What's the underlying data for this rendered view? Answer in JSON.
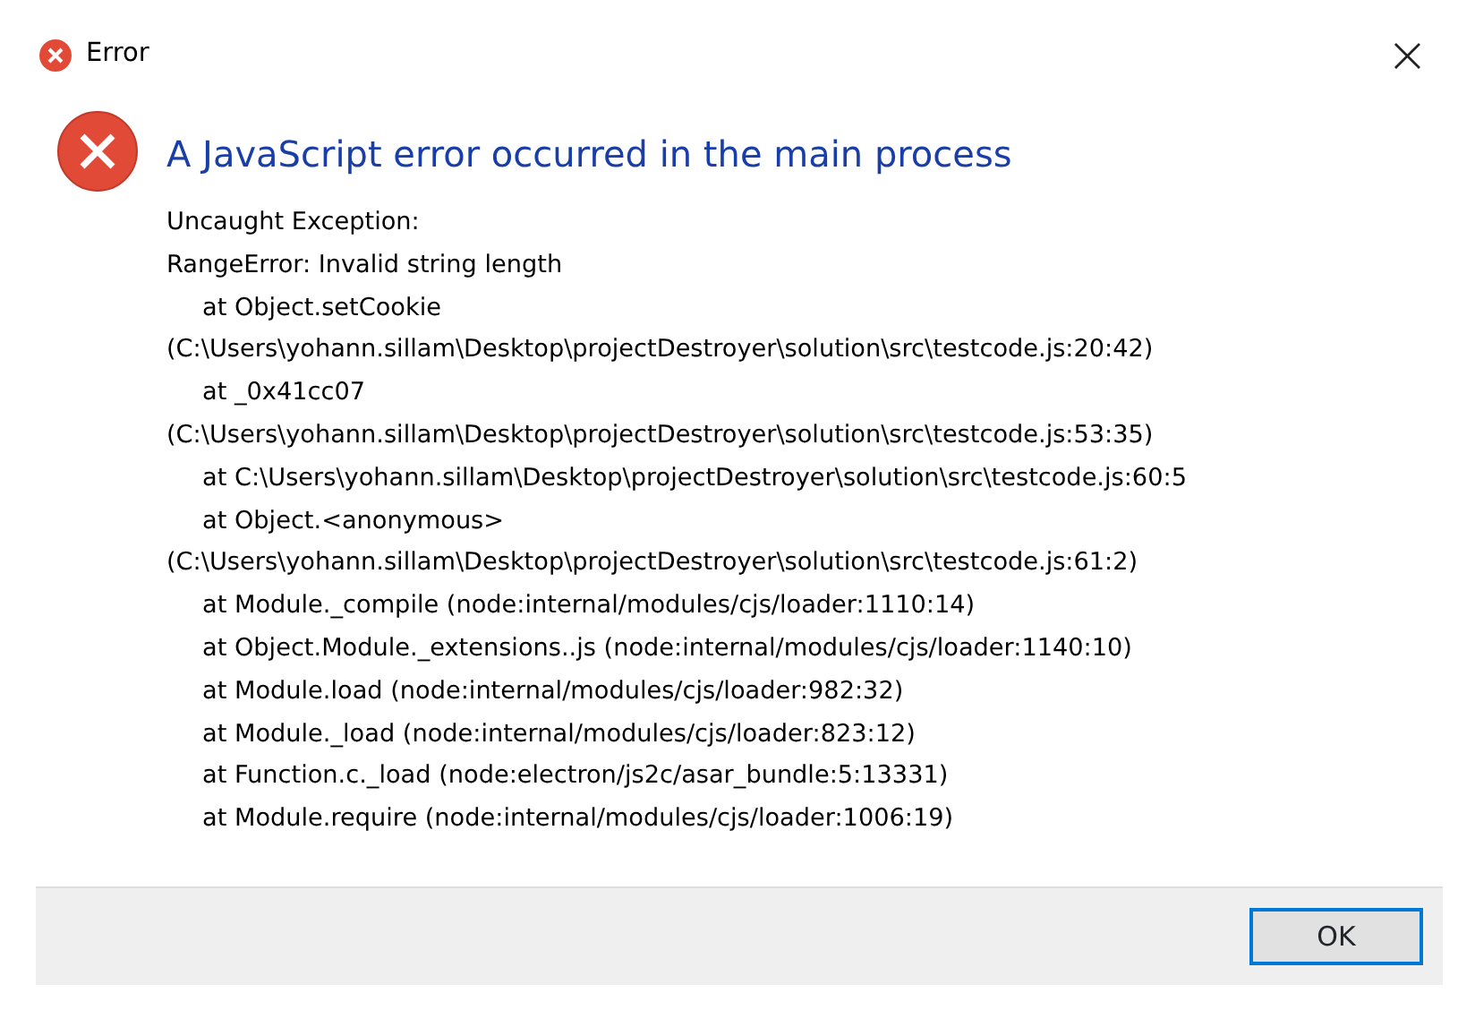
{
  "window": {
    "title": "Error",
    "close_glyph": "×"
  },
  "heading": "A JavaScript error occurred in the main process",
  "details": [
    {
      "kind": "message",
      "text": "Uncaught Exception:"
    },
    {
      "kind": "message",
      "text": "RangeError: Invalid string length"
    },
    {
      "kind": "frame",
      "text": "at Object.setCookie"
    },
    {
      "kind": "message",
      "text": "(C:\\Users\\yohann.sillam\\Desktop\\projectDestroyer\\solution\\src\\testcode.js:20:42)"
    },
    {
      "kind": "frame",
      "text": "at _0x41cc07"
    },
    {
      "kind": "message",
      "text": "(C:\\Users\\yohann.sillam\\Desktop\\projectDestroyer\\solution\\src\\testcode.js:53:35)"
    },
    {
      "kind": "frame",
      "text": "at C:\\Users\\yohann.sillam\\Desktop\\projectDestroyer\\solution\\src\\testcode.js:60:5"
    },
    {
      "kind": "frame",
      "text": "at Object.<anonymous>"
    },
    {
      "kind": "message",
      "text": "(C:\\Users\\yohann.sillam\\Desktop\\projectDestroyer\\solution\\src\\testcode.js:61:2)"
    },
    {
      "kind": "frame",
      "text": "at Module._compile (node:internal/modules/cjs/loader:1110:14)"
    },
    {
      "kind": "frame",
      "text": "at Object.Module._extensions..js (node:internal/modules/cjs/loader:1140:10)"
    },
    {
      "kind": "frame",
      "text": "at Module.load (node:internal/modules/cjs/loader:982:32)"
    },
    {
      "kind": "frame",
      "text": "at Module._load (node:internal/modules/cjs/loader:823:12)"
    },
    {
      "kind": "frame",
      "text": "at Function.c._load (node:electron/js2c/asar_bundle:5:13331)"
    },
    {
      "kind": "frame",
      "text": "at Module.require (node:internal/modules/cjs/loader:1006:19)"
    }
  ],
  "buttons": [
    {
      "label": "OK",
      "selected": true
    }
  ]
}
